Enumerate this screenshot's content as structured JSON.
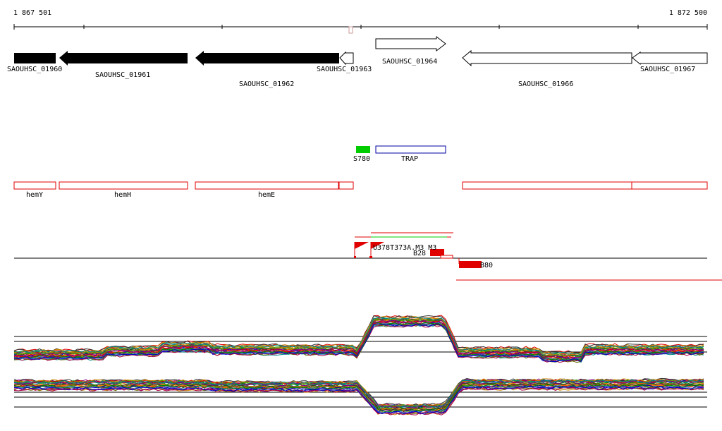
{
  "browser": {
    "range_start": "1 867 501",
    "range_end": "1 872 500"
  },
  "colors": {
    "black": "#000000",
    "red": "#e00000",
    "green": "#00cc00",
    "navy": "#0000a0",
    "grid": "#000000"
  },
  "genes": [
    {
      "id": "gene-saouhsc-01960",
      "label": "SAOUHSC_01960"
    },
    {
      "id": "gene-saouhsc-01961",
      "label": "SAOUHSC_01961"
    },
    {
      "id": "gene-saouhsc-01962",
      "label": "SAOUHSC_01962"
    },
    {
      "id": "gene-saouhsc-01963",
      "label": "SAOUHSC_01963"
    },
    {
      "id": "gene-saouhsc-01964",
      "label": "SAOUHSC_01964"
    },
    {
      "id": "gene-saouhsc-01966",
      "label": "SAOUHSC_01966"
    },
    {
      "id": "gene-saouhsc-01967",
      "label": "SAOUHSC_01967"
    }
  ],
  "features": [
    {
      "id": "feature-s780",
      "label": "S780"
    },
    {
      "id": "feature-trap",
      "label": "TRAP"
    }
  ],
  "operons": [
    {
      "id": "operon-hemy",
      "label": "hemY"
    },
    {
      "id": "operon-hemh",
      "label": "hemH"
    },
    {
      "id": "operon-heme",
      "label": "hemE"
    }
  ],
  "transcripts": {
    "overlap_label": "U378T373A.M3 M3",
    "label_b": "B28",
    "label_c": "B80"
  }
}
